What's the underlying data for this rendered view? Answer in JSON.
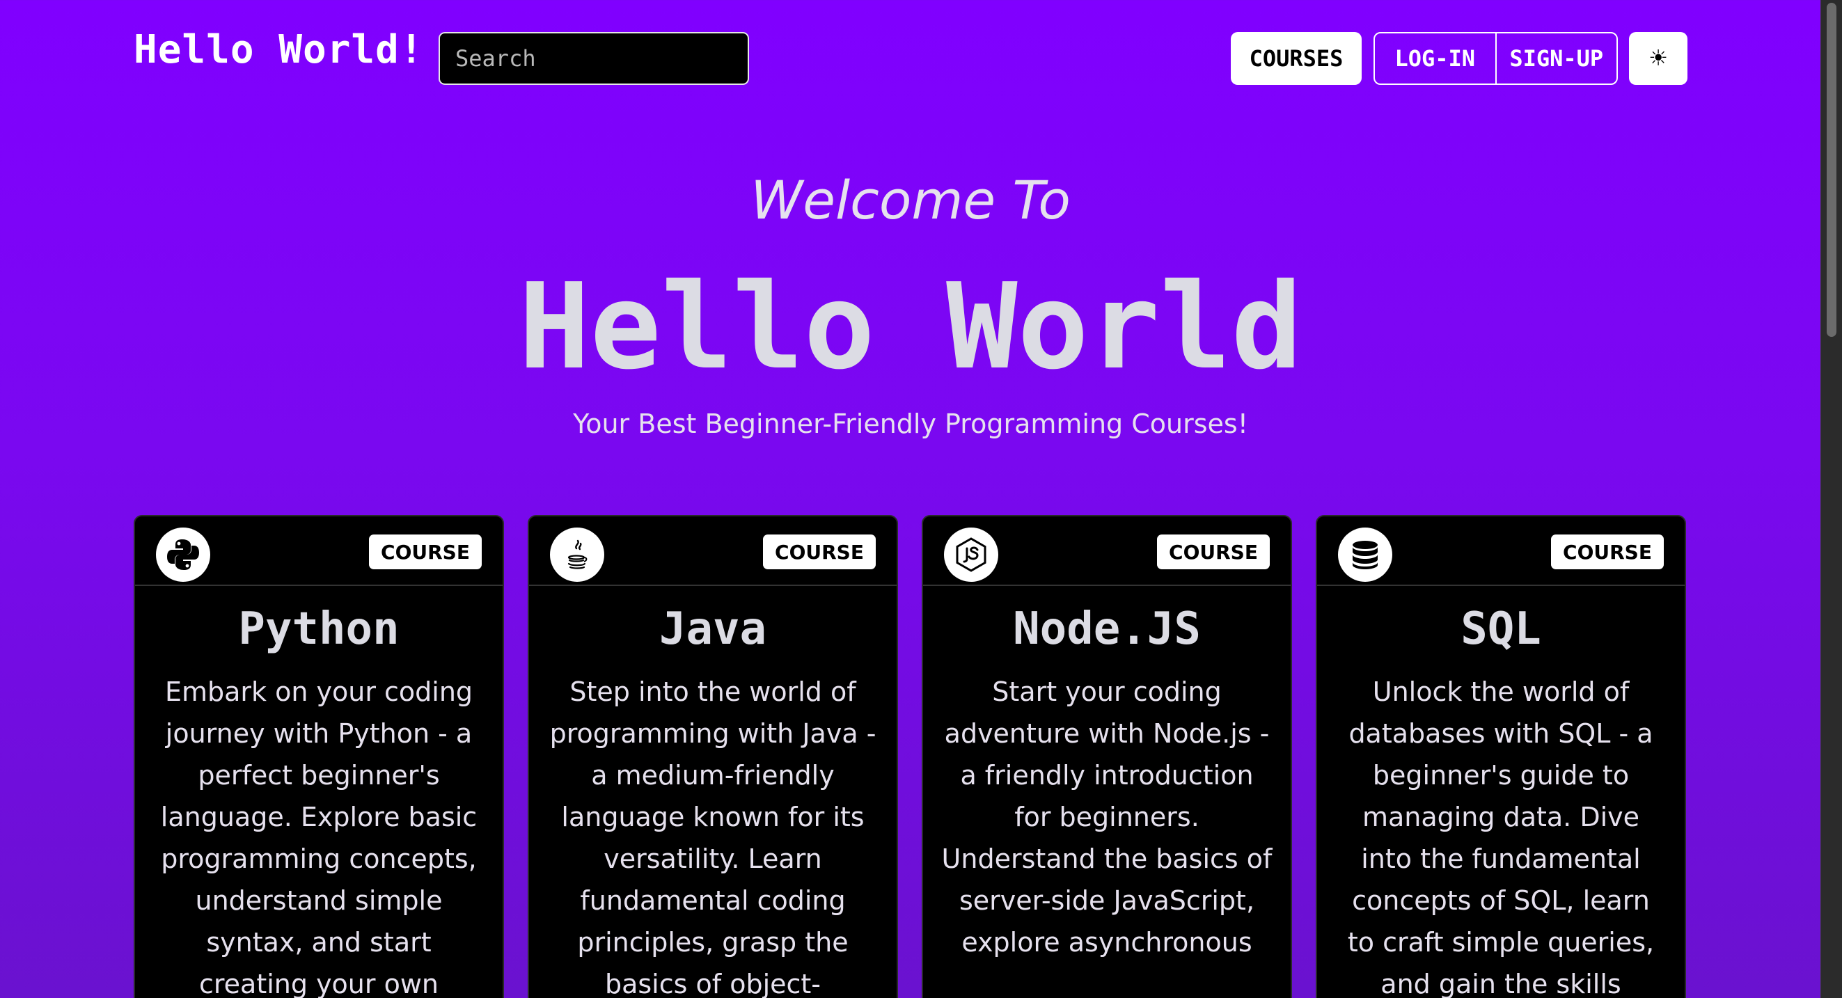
{
  "header": {
    "brand": "Hello World!",
    "search_placeholder": "Search",
    "courses_label": "COURSES",
    "login_label": "LOG-IN",
    "signup_label": "SIGN-UP",
    "theme_icon": "sun-icon",
    "theme_glyph": "☀"
  },
  "hero": {
    "welcome": "Welcome To",
    "title": "Hello World",
    "subtitle": "Your Best Beginner-Friendly Programming Courses!"
  },
  "cards": [
    {
      "icon": "python-icon",
      "badge": "COURSE",
      "title": "Python",
      "description": "Embark on your coding journey with Python - a perfect beginner's language. Explore basic programming concepts, understand simple syntax, and start creating your own"
    },
    {
      "icon": "java-icon",
      "badge": "COURSE",
      "title": "Java",
      "description": "Step into the world of programming with Java - a medium-friendly language known for its versatility. Learn fundamental coding principles, grasp the basics of object-"
    },
    {
      "icon": "nodejs-icon",
      "badge": "COURSE",
      "title": "Node.JS",
      "description": "Start your coding adventure with Node.js - a friendly introduction for beginners. Understand the basics of server-side JavaScript, explore asynchronous"
    },
    {
      "icon": "database-icon",
      "badge": "COURSE",
      "title": "SQL",
      "description": "Unlock the world of databases with SQL - a beginner's guide to managing data. Dive into the fundamental concepts of SQL, learn to craft simple queries, and gain the skills"
    }
  ],
  "colors": {
    "background_top": "#8000ff",
    "background_bottom": "#6a12cf",
    "card_background": "#000000",
    "text_light": "#e6e1ee"
  }
}
